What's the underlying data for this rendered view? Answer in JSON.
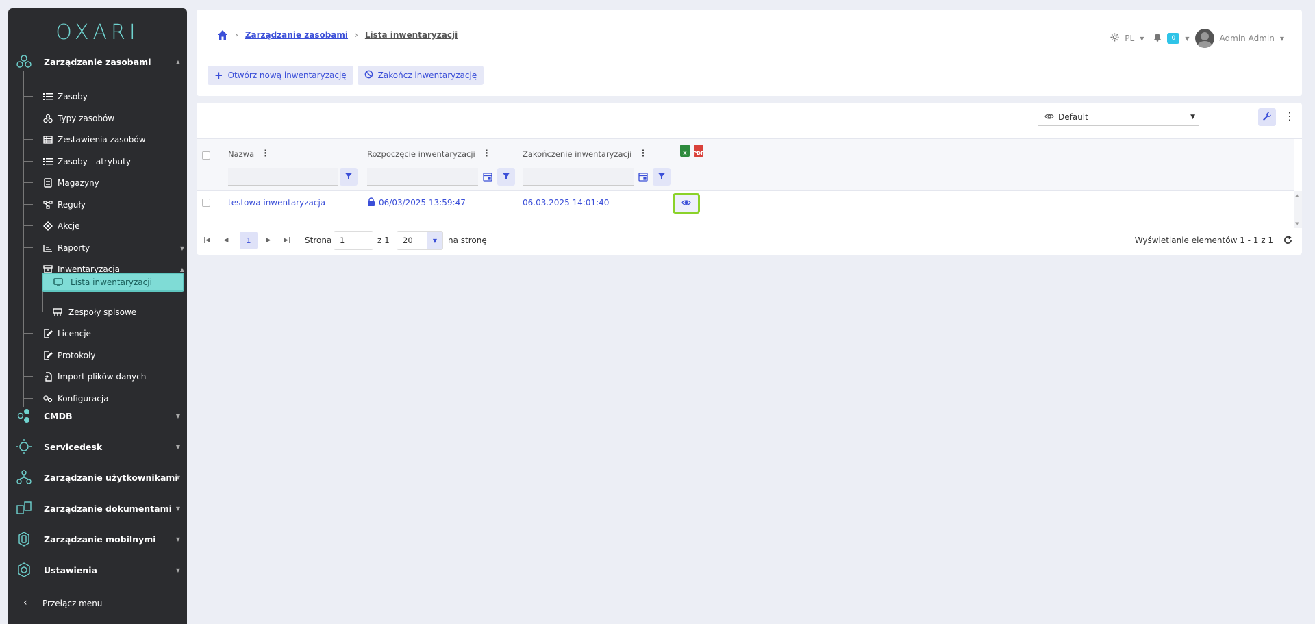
{
  "app": {
    "logo_text": "OXARI"
  },
  "sidebar": {
    "sections": [
      {
        "label": "Zarządzanie zasobami",
        "icon": "asset-management-icon",
        "expanded": true
      },
      {
        "label": "CMDB",
        "icon": "cmdb-icon"
      },
      {
        "label": "Servicedesk",
        "icon": "servicedesk-icon"
      },
      {
        "label": "Zarządzanie użytkownikami",
        "icon": "user-management-icon"
      },
      {
        "label": "Zarządzanie dokumentami",
        "icon": "document-management-icon"
      },
      {
        "label": "Zarządzanie mobilnymi",
        "icon": "mobile-management-icon"
      },
      {
        "label": "Ustawienia",
        "icon": "settings-icon"
      }
    ],
    "items": [
      {
        "label": "Zasoby",
        "icon": "list-icon"
      },
      {
        "label": "Typy zasobów",
        "icon": "types-icon"
      },
      {
        "label": "Zestawienia zasobów",
        "icon": "table-icon"
      },
      {
        "label": "Zasoby - atrybuty",
        "icon": "list-icon"
      },
      {
        "label": "Magazyny",
        "icon": "warehouse-icon"
      },
      {
        "label": "Reguły",
        "icon": "rules-icon"
      },
      {
        "label": "Akcje",
        "icon": "actions-icon"
      },
      {
        "label": "Raporty",
        "icon": "reports-icon"
      },
      {
        "label": "Inwentaryzacja",
        "icon": "inventory-icon"
      },
      {
        "label": "Licencje",
        "icon": "license-icon"
      },
      {
        "label": "Protokoły",
        "icon": "protocol-icon"
      },
      {
        "label": "Import plików danych",
        "icon": "import-icon"
      },
      {
        "label": "Konfiguracja",
        "icon": "config-icon"
      }
    ],
    "inventory_children": [
      {
        "label": "Lista inwentaryzacji",
        "icon": "monitor-icon",
        "active": true
      },
      {
        "label": "Zespoły spisowe",
        "icon": "team-icon"
      }
    ],
    "toggle_label": "Przełącz menu"
  },
  "header": {
    "breadcrumb": [
      "Zarządzanie zasobami",
      "Lista inwentaryzacji"
    ],
    "language": "PL",
    "notifications_count": "0",
    "user_name": "Admin Admin"
  },
  "toolbar": {
    "open_label": "Otwórz nową inwentaryzację",
    "close_label": "Zakończ inwentaryzację"
  },
  "grid": {
    "view_name": "Default",
    "columns": [
      "Nazwa",
      "Rozpoczęcie inwentaryzacji",
      "Zakończenie inwentaryzacji"
    ],
    "export": {
      "excel": "X",
      "pdf": "PDF"
    },
    "rows": [
      {
        "name": "testowa inwentaryzacja",
        "start": "06/03/2025 13:59:47",
        "end": "06.03.2025 14:01:40"
      }
    ]
  },
  "pager": {
    "current_page": "1",
    "page_label": "Strona",
    "page_input": "1",
    "of_label": "z 1",
    "page_size": "20",
    "per_page_label": "na stronę",
    "summary": "Wyświetlanie elementów 1 - 1 z 1"
  },
  "colors": {
    "accent": "#3b4fd8",
    "sidebar_bg": "#2b2c2f",
    "active_item": "#7fdcd6",
    "highlight": "#8bd22a"
  }
}
